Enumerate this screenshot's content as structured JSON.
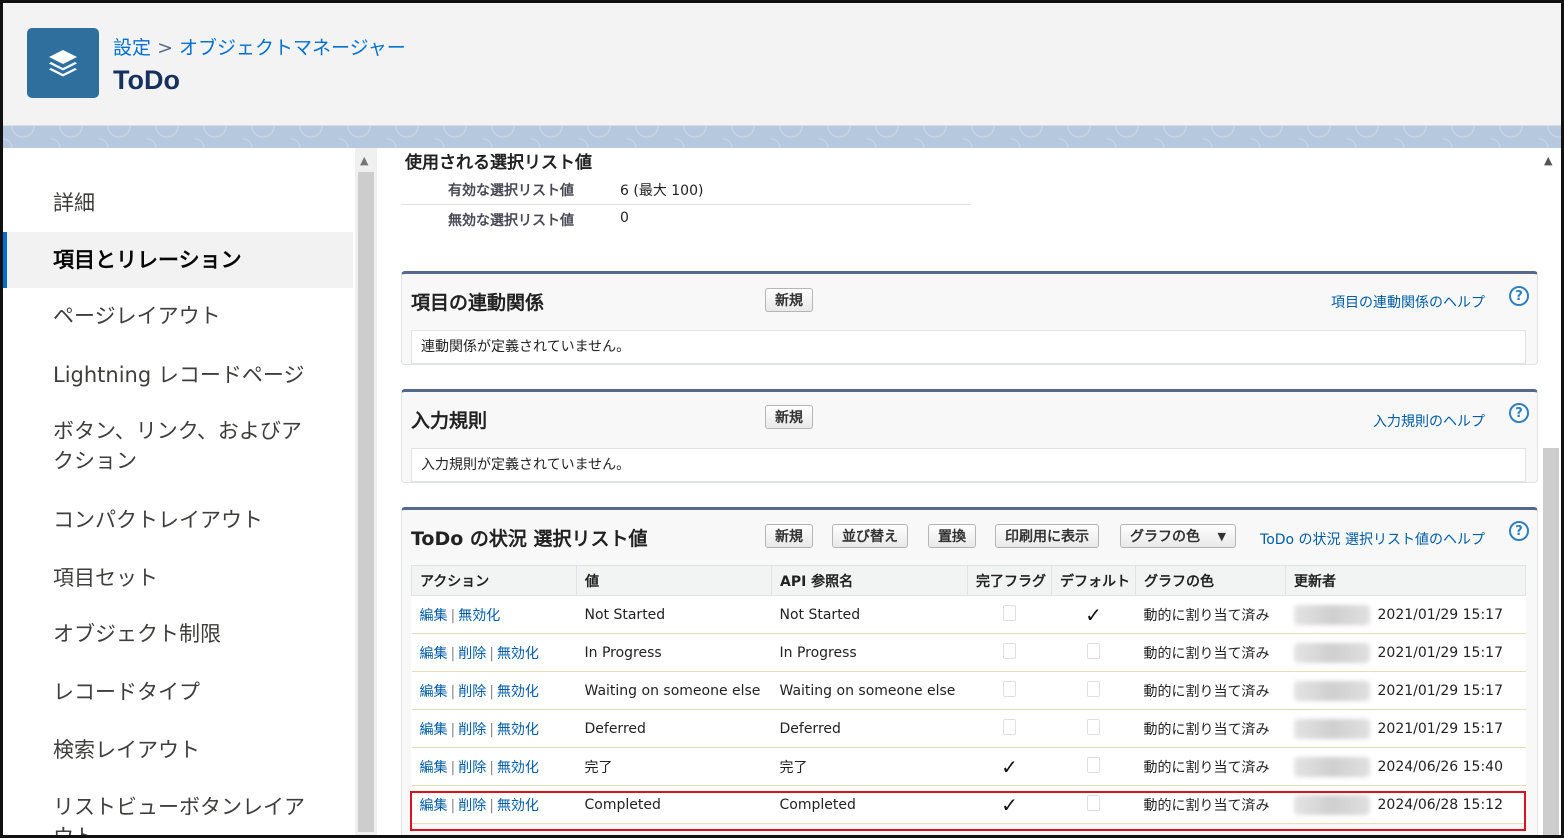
{
  "header": {
    "breadcrumb_root": "設定",
    "breadcrumb_sep": ">",
    "breadcrumb_current": "オブジェクトマネージャー",
    "title": "ToDo",
    "icon": "layers-icon"
  },
  "sidebar": {
    "items": [
      {
        "label": "詳細"
      },
      {
        "label": "項目とリレーション",
        "active": true
      },
      {
        "label": "ページレイアウト"
      },
      {
        "label": "Lightning レコードページ"
      },
      {
        "label": "ボタン、リンク、およびア\nクション"
      },
      {
        "label": "コンパクトレイアウト"
      },
      {
        "label": "項目セット"
      },
      {
        "label": "オブジェクト制限"
      },
      {
        "label": "レコードタイプ"
      },
      {
        "label": "検索レイアウト"
      },
      {
        "label": "リストビューボタンレイア\nウト"
      }
    ]
  },
  "usage": {
    "title": "使用される選択リスト値",
    "active_label": "有効な選択リスト値",
    "active_value": "6 (最大 100)",
    "inactive_label": "無効な選択リスト値",
    "inactive_value": "0"
  },
  "dependencies": {
    "title": "項目の連動関係",
    "new_button": "新規",
    "help_link": "項目の連動関係のヘルプ",
    "empty_text": "連動関係が定義されていません。"
  },
  "validation": {
    "title": "入力規則",
    "new_button": "新規",
    "help_link": "入力規則のヘルプ",
    "empty_text": "入力規則が定義されていません。"
  },
  "picklist": {
    "title": "ToDo の状況 選択リスト値",
    "buttons": {
      "new": "新規",
      "reorder": "並び替え",
      "replace": "置換",
      "print": "印刷用に表示",
      "chart_color": "グラフの色"
    },
    "help_link": "ToDo の状況 選択リスト値のヘルプ",
    "columns": [
      "アクション",
      "値",
      "API 参照名",
      "完了フラグ",
      "デフォルト",
      "グラフの色",
      "更新者"
    ],
    "action_edit": "編集",
    "action_delete": "削除",
    "action_deactivate": "無効化",
    "rows": [
      {
        "value": "Not Started",
        "api": "Not Started",
        "closed": false,
        "default": true,
        "color": "動的に割り当て済み",
        "modified": "2021/01/29 15:17",
        "can_delete": false
      },
      {
        "value": "In Progress",
        "api": "In Progress",
        "closed": false,
        "default": false,
        "color": "動的に割り当て済み",
        "modified": "2021/01/29 15:17",
        "can_delete": true
      },
      {
        "value": "Waiting on someone else",
        "api": "Waiting on someone else",
        "closed": false,
        "default": false,
        "color": "動的に割り当て済み",
        "modified": "2021/01/29 15:17",
        "can_delete": true
      },
      {
        "value": "Deferred",
        "api": "Deferred",
        "closed": false,
        "default": false,
        "color": "動的に割り当て済み",
        "modified": "2021/01/29 15:17",
        "can_delete": true
      },
      {
        "value": "完了",
        "api": "完了",
        "closed": true,
        "default": false,
        "color": "動的に割り当て済み",
        "modified": "2024/06/26 15:40",
        "can_delete": true
      },
      {
        "value": "Completed",
        "api": "Completed",
        "closed": true,
        "default": false,
        "color": "動的に割り当て済み",
        "modified": "2024/06/28 15:12",
        "can_delete": true
      }
    ],
    "highlight_color": "#d9141e"
  }
}
